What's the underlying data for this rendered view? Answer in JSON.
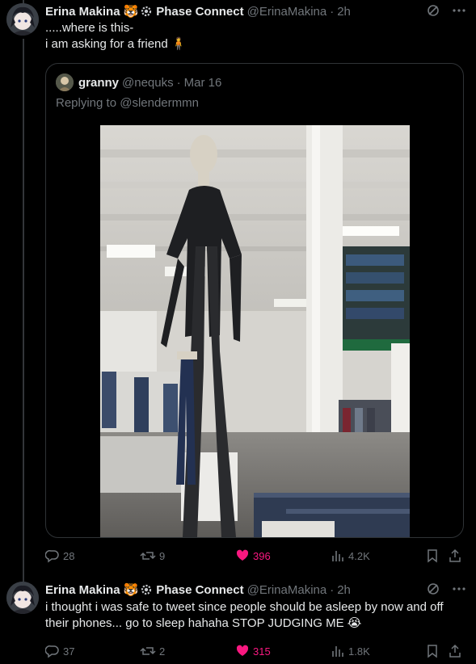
{
  "tweets": [
    {
      "author_name": "Erina Makina",
      "badge_emoji": "🐯",
      "affiliation": "Phase Connect",
      "handle": "@ErinaMakina",
      "separator": "·",
      "time": "2h",
      "text_line1": ".....where is this-",
      "text_line2": "i am asking for a friend",
      "text_emoji": "🧍",
      "quote": {
        "name": "granny",
        "handle": "@nequks",
        "separator": "·",
        "time": "Mar 16",
        "replying_prefix": "Replying to ",
        "replying_to": "@slendermmn",
        "media_icon": "photo-mannequin"
      },
      "stats": {
        "replies": "28",
        "retweets": "9",
        "likes": "396",
        "views": "4.2K"
      }
    },
    {
      "author_name": "Erina Makina",
      "badge_emoji": "🐯",
      "affiliation": "Phase Connect",
      "handle": "@ErinaMakina",
      "separator": "·",
      "time": "2h",
      "text": "i thought i was safe to tweet since people should be asleep by now and off their phones... go to sleep hahaha STOP JUDGING ME 😭",
      "stats": {
        "replies": "37",
        "retweets": "2",
        "likes": "315",
        "views": "1.8K"
      }
    }
  ],
  "icons": {
    "grok": "grok-icon",
    "more": "more-icon",
    "reply": "reply-icon",
    "retweet": "retweet-icon",
    "like": "heart-icon",
    "views": "views-icon",
    "bookmark": "bookmark-icon",
    "share": "share-icon"
  },
  "colors": {
    "background": "#000000",
    "text": "#e7e9ea",
    "muted": "#71767b",
    "like": "#f91880",
    "border": "#2f3336"
  }
}
